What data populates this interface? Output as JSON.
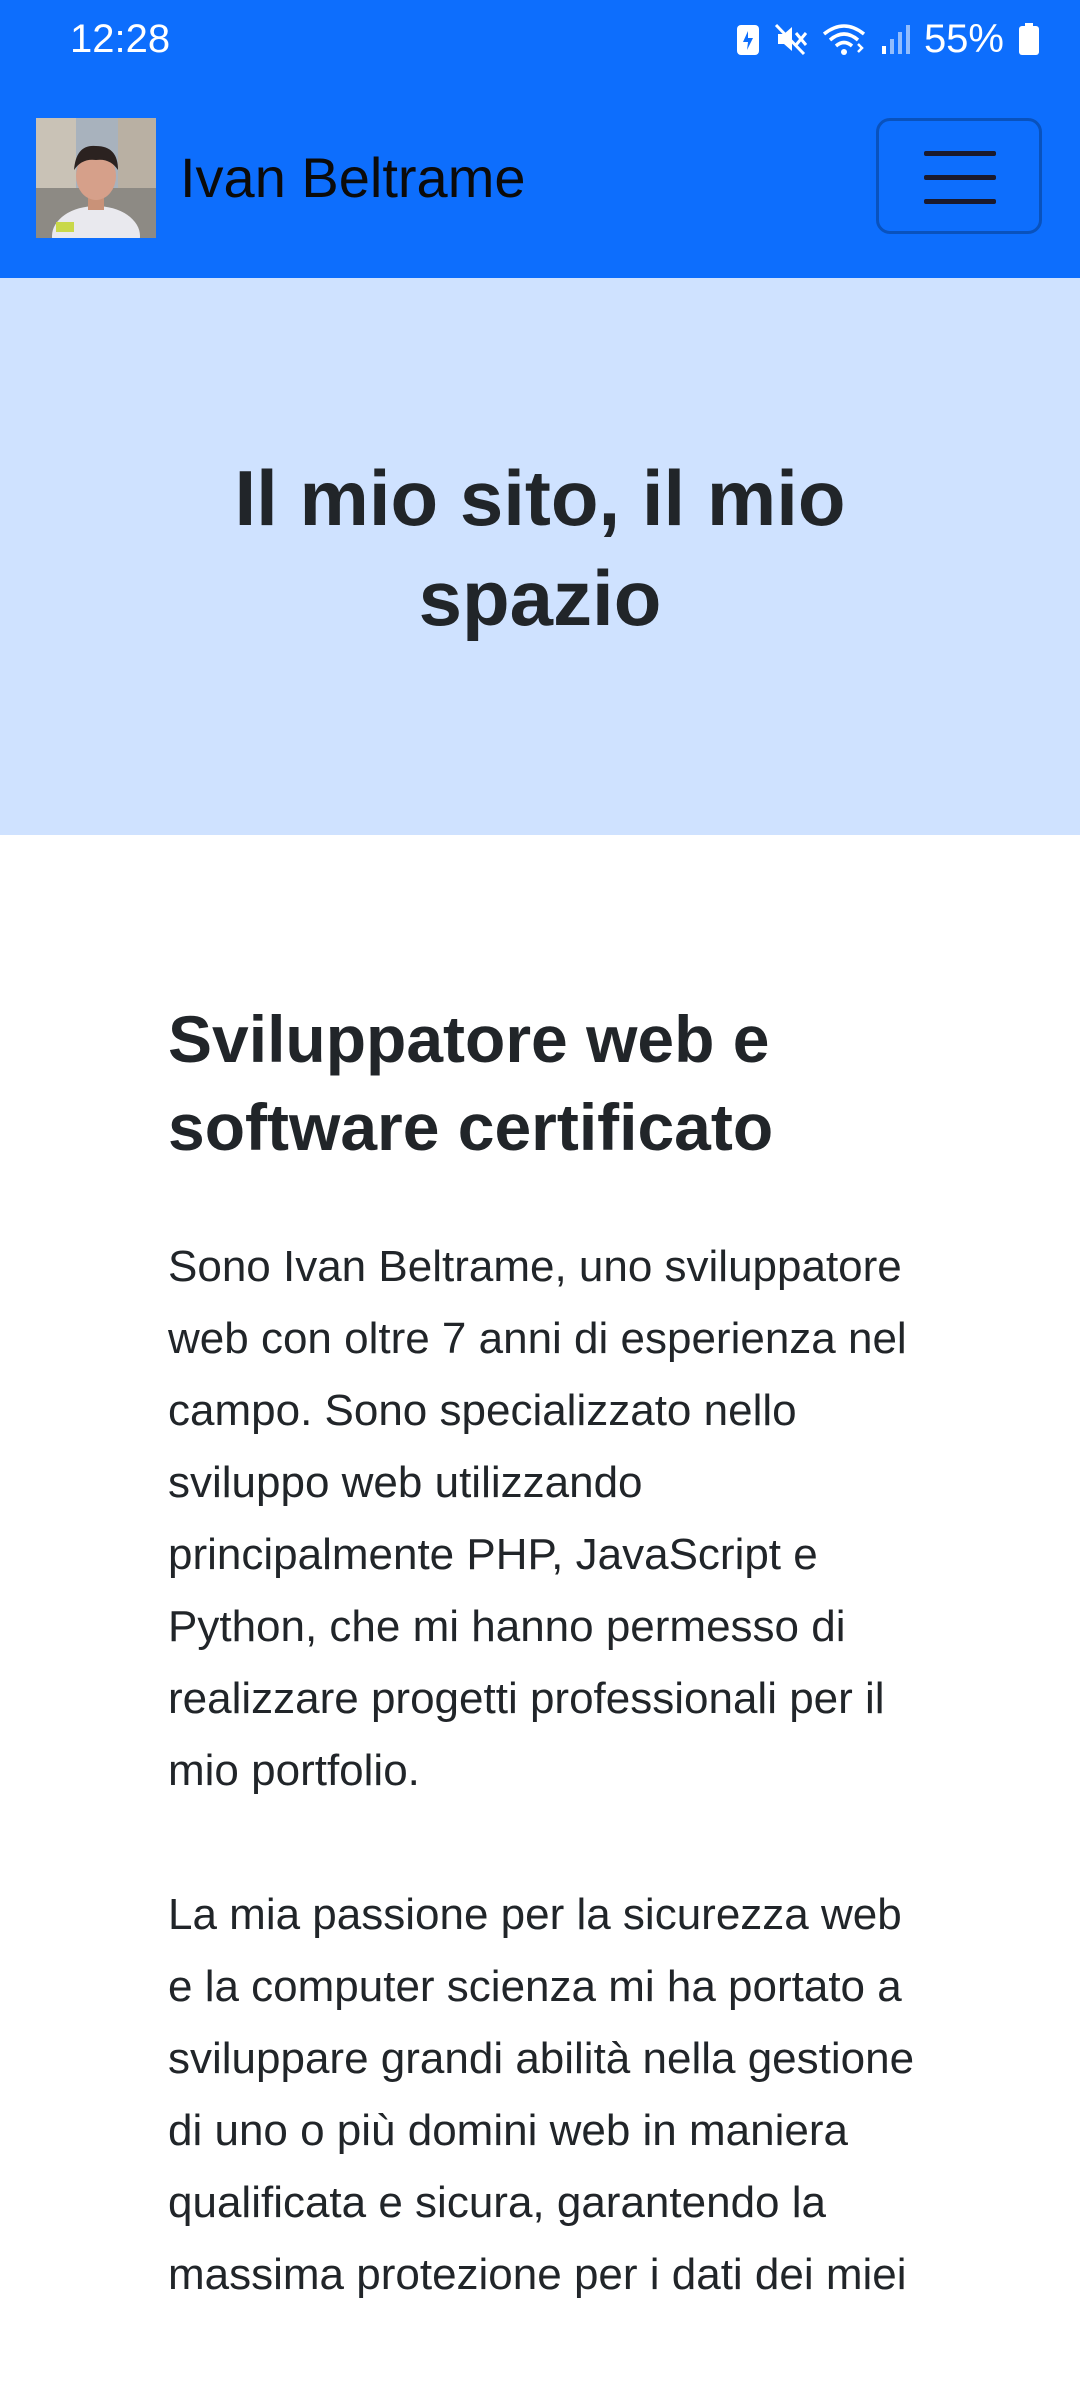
{
  "status_bar": {
    "time": "12:28",
    "battery": "55%",
    "icons": [
      "data-saver-icon",
      "mute-icon",
      "wifi-icon",
      "signal-icon",
      "battery-icon"
    ]
  },
  "navbar": {
    "brand_name": "Ivan Beltrame",
    "background_color": "#0d6efd"
  },
  "hero": {
    "title": "Il mio sito, il mio spazio",
    "background_color": "#cfe2ff"
  },
  "about": {
    "title": "Sviluppatore web e software certificato",
    "paragraphs": [
      "Sono Ivan Beltrame, uno sviluppatore web con oltre 7 anni di esperienza nel campo. Sono specializzato nello sviluppo web utilizzando principalmente PHP, JavaScript e Python, che mi hanno permesso di realizzare progetti professionali per il mio portfolio.",
      "La mia passione per la sicurezza web e la computer scienza mi ha portato a sviluppare grandi abilità nella gestione di uno o più domini web in maniera qualificata e sicura, garantendo la massima protezione per i dati dei miei"
    ]
  }
}
